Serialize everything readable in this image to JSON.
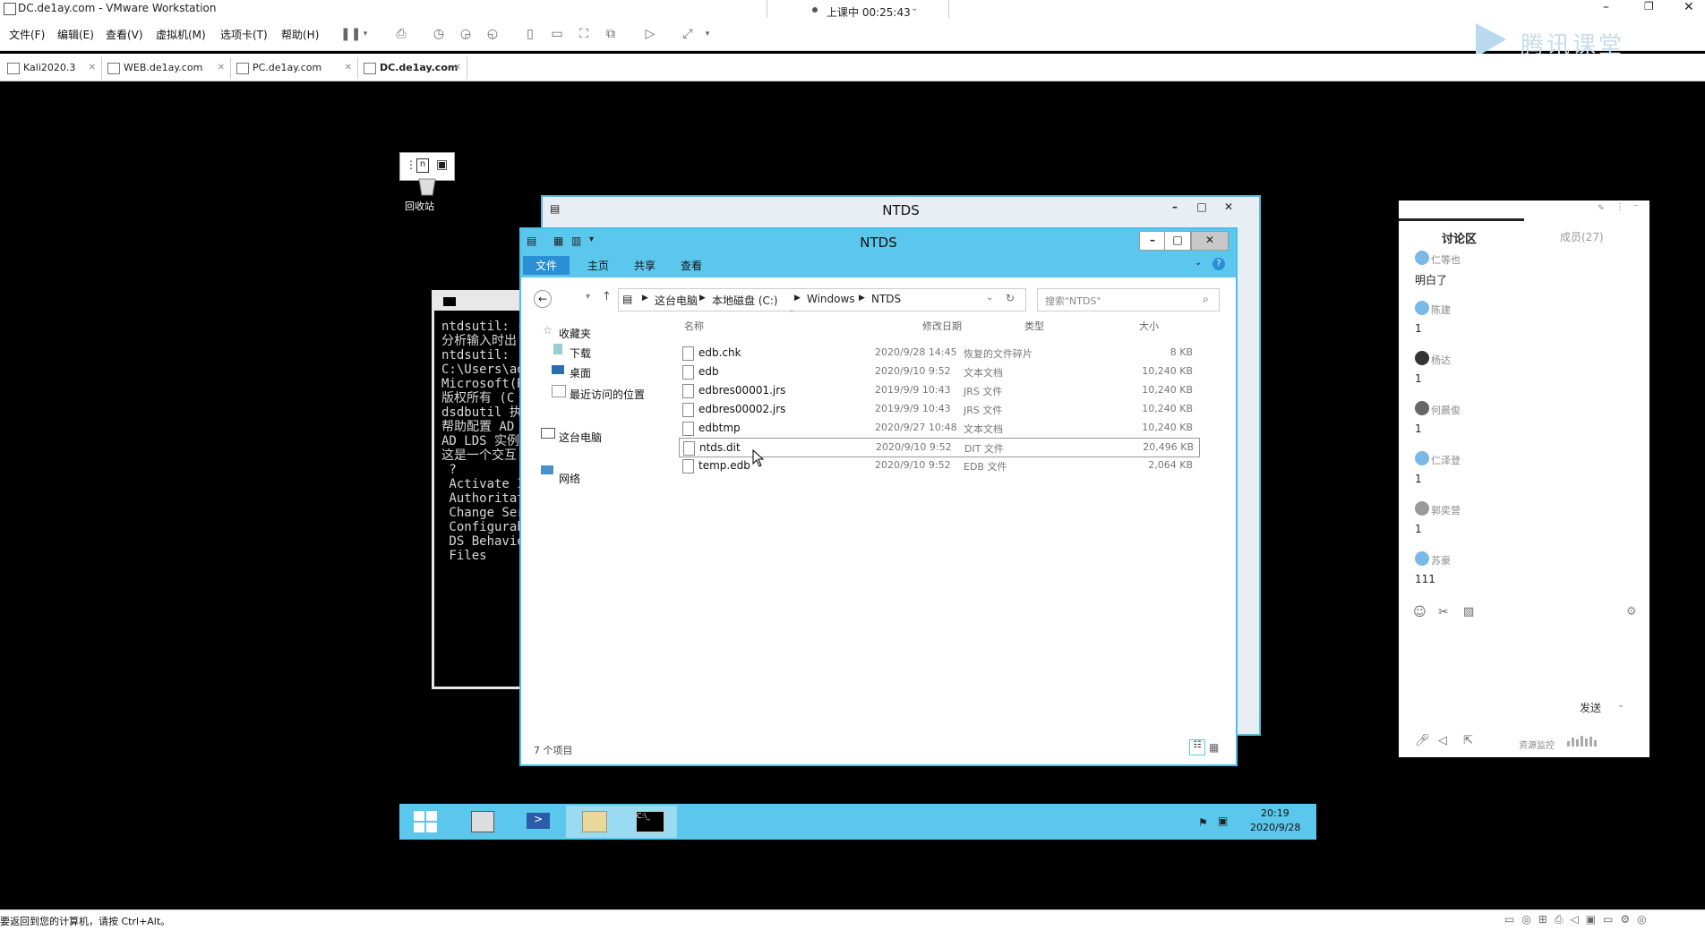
{
  "vm": {
    "title": "DC.de1ay.com - VMware Workstation",
    "session_status": "上课中 00:25:43",
    "menu": [
      "文件(F)",
      "编辑(E)",
      "查看(V)",
      "虚拟机(M)",
      "选项卡(T)",
      "帮助(H)"
    ],
    "tabs": [
      "Kali2020.3",
      "WEB.de1ay.com",
      "PC.de1ay.com",
      "DC.de1ay.com"
    ],
    "status_bar": "要返回到您的计算机，请按 Ctrl+Alt。",
    "watermark": "腾讯课堂"
  },
  "desktop": {
    "recycle_bin_label": "回收站"
  },
  "cmd": {
    "lines": [
      "ntdsutil: -",
      "分析输入时出",
      "ntdsutil:",
      "C:\\Users\\ad",
      "Microsoft(R",
      "版权所有 (C",
      "",
      "dsdbutil 执",
      "帮助配置 AD",
      "AD LDS 实例",
      "",
      "这是一个交互",
      "",
      "",
      " ?",
      " Activate I",
      "",
      " Authoritat",
      " Change Ser",
      "",
      "",
      "",
      " Configurab",
      " DS Behavio",
      " Files"
    ]
  },
  "explorer_back": {
    "title": "NTDS"
  },
  "explorer": {
    "title": "NTDS",
    "ribbon_tabs": [
      "文件",
      "主页",
      "共享",
      "查看"
    ],
    "breadcrumb": [
      "这台电脑",
      "本地磁盘 (C:)",
      "Windows",
      "NTDS"
    ],
    "search_placeholder": "搜索\"NTDS\"",
    "nav": {
      "favorites": "收藏夹",
      "downloads": "下载",
      "desktop": "桌面",
      "recent": "最近访问的位置",
      "this_pc": "这台电脑",
      "network": "网络"
    },
    "columns": [
      "名称",
      "修改日期",
      "类型",
      "大小"
    ],
    "files": [
      {
        "name": "edb.chk",
        "date": "2020/9/28 14:45",
        "type": "恢复的文件碎片",
        "size": "8 KB"
      },
      {
        "name": "edb",
        "date": "2020/9/10 9:52",
        "type": "文本文档",
        "size": "10,240 KB"
      },
      {
        "name": "edbres00001.jrs",
        "date": "2019/9/9 10:43",
        "type": "JRS 文件",
        "size": "10,240 KB"
      },
      {
        "name": "edbres00002.jrs",
        "date": "2019/9/9 10:43",
        "type": "JRS 文件",
        "size": "10,240 KB"
      },
      {
        "name": "edbtmp",
        "date": "2020/9/27 10:48",
        "type": "文本文档",
        "size": "10,240 KB"
      },
      {
        "name": "ntds.dit",
        "date": "2020/9/10 9:52",
        "type": "DIT 文件",
        "size": "20,496 KB"
      },
      {
        "name": "temp.edb",
        "date": "2020/9/10 9:52",
        "type": "EDB 文件",
        "size": "2,064 KB"
      }
    ],
    "item_count": "7 个项目"
  },
  "taskbar": {
    "time": "20:19",
    "date": "2020/9/28"
  },
  "chat": {
    "tab_discussion": "讨论区",
    "tab_members": "成员(27)",
    "messages": [
      {
        "user": "仁等也",
        "text": "明白了"
      },
      {
        "user": "陈建",
        "text": "1"
      },
      {
        "user": "杨达",
        "text": "1"
      },
      {
        "user": "何晨俊",
        "text": "1"
      },
      {
        "user": "仁泽登",
        "text": "1"
      },
      {
        "user": "郭奕营",
        "text": "1"
      },
      {
        "user": "苏豪",
        "text": "111"
      }
    ],
    "send_label": "发送",
    "resource_label": "资源监控"
  },
  "colors": {
    "accent": "#5bc7ec",
    "ribbon_active": "#2a8fd5"
  }
}
